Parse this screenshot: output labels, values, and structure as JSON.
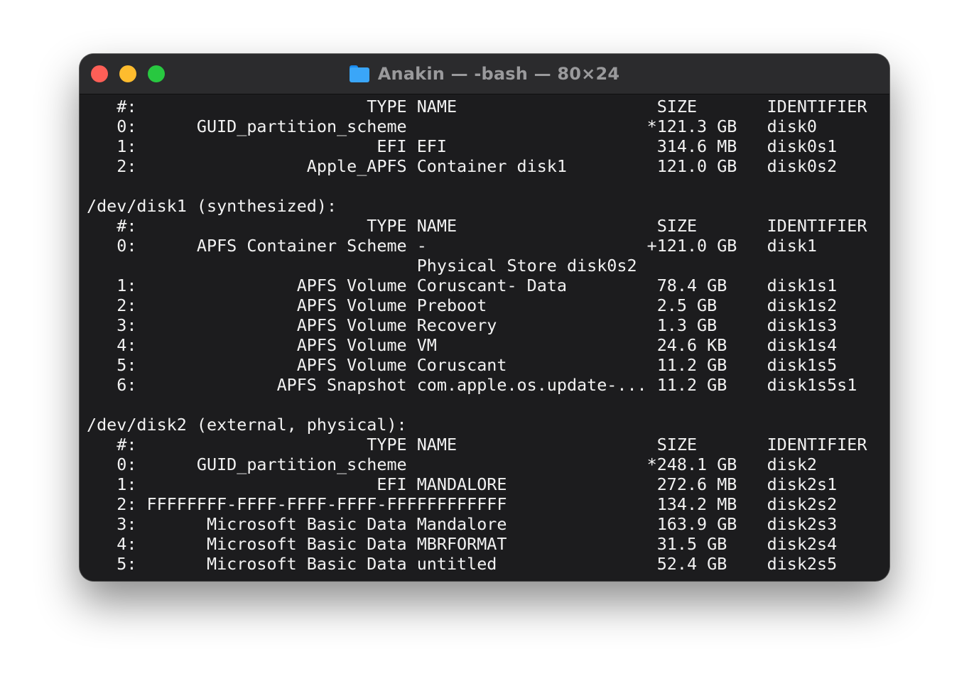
{
  "window": {
    "title": "Anakin — -bash — 80×24",
    "title_icon": "folder-icon",
    "colors": {
      "close": "#fe5f57",
      "minimize": "#febc2e",
      "zoom": "#28c840",
      "background": "#1c1c1e",
      "text": "#f2f2f2"
    }
  },
  "terminal": {
    "lines": [
      "   #:                       TYPE NAME                    SIZE       IDENTIFIER",
      "   0:      GUID_partition_scheme                        *121.3 GB   disk0",
      "   1:                        EFI EFI                     314.6 MB   disk0s1",
      "   2:                 Apple_APFS Container disk1         121.0 GB   disk0s2",
      "",
      "/dev/disk1 (synthesized):",
      "   #:                       TYPE NAME                    SIZE       IDENTIFIER",
      "   0:      APFS Container Scheme -                      +121.0 GB   disk1",
      "                                 Physical Store disk0s2",
      "   1:                APFS Volume Coruscant- Data         78.4 GB    disk1s1",
      "   2:                APFS Volume Preboot                 2.5 GB     disk1s2",
      "   3:                APFS Volume Recovery                1.3 GB     disk1s3",
      "   4:                APFS Volume VM                      24.6 KB    disk1s4",
      "   5:                APFS Volume Coruscant               11.2 GB    disk1s5",
      "   6:              APFS Snapshot com.apple.os.update-... 11.2 GB    disk1s5s1",
      "",
      "/dev/disk2 (external, physical):",
      "   #:                       TYPE NAME                    SIZE       IDENTIFIER",
      "   0:      GUID_partition_scheme                        *248.1 GB   disk2",
      "   1:                        EFI MANDALORE               272.6 MB   disk2s1",
      "   2: FFFFFFFF-FFFF-FFFF-FFFF-FFFFFFFFFFFF               134.2 MB   disk2s2",
      "   3:       Microsoft Basic Data Mandalore               163.9 GB   disk2s3",
      "   4:       Microsoft Basic Data MBRFORMAT               31.5 GB    disk2s4",
      "   5:       Microsoft Basic Data untitled                52.4 GB    disk2s5"
    ]
  }
}
